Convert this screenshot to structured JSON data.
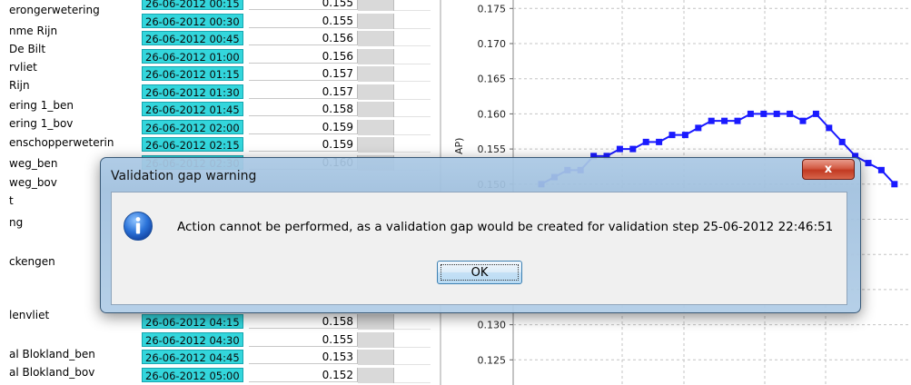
{
  "locations": [
    {
      "label": "erongerwetering",
      "y": 17
    },
    {
      "label": "nme Rijn",
      "y": 40
    },
    {
      "label": " De Bilt",
      "y": 60
    },
    {
      "label": "rvliet",
      "y": 80
    },
    {
      "label": " Rijn",
      "y": 100
    },
    {
      "label": "ering 1_ben",
      "y": 122
    },
    {
      "label": "ering 1_bov",
      "y": 142
    },
    {
      "label": "enschopperweterin",
      "y": 163
    },
    {
      "label": "weg_ben",
      "y": 186
    },
    {
      "label": "weg_bov",
      "y": 207
    },
    {
      "label": "t",
      "y": 227
    },
    {
      "label": "ng",
      "y": 251
    },
    {
      "label": "ckengen",
      "y": 294
    },
    {
      "label": "lenvliet",
      "y": 353
    },
    {
      "label": "al Blokland_ben",
      "y": 396
    },
    {
      "label": "al Blokland_bov",
      "y": 416
    }
  ],
  "table_rows": [
    {
      "date": "26-06-2012 00:15",
      "value": "0.155"
    },
    {
      "date": "26-06-2012 00:30",
      "value": "0.155"
    },
    {
      "date": "26-06-2012 00:45",
      "value": "0.156"
    },
    {
      "date": "26-06-2012 01:00",
      "value": "0.156"
    },
    {
      "date": "26-06-2012 01:15",
      "value": "0.157"
    },
    {
      "date": "26-06-2012 01:30",
      "value": "0.157"
    },
    {
      "date": "26-06-2012 01:45",
      "value": "0.158"
    },
    {
      "date": "26-06-2012 02:00",
      "value": "0.159"
    },
    {
      "date": "26-06-2012 02:15",
      "value": "0.159"
    },
    {
      "date": "26-06-2012 02:30",
      "value": "0.160"
    }
  ],
  "table_rows_bottom": [
    {
      "date": "26-06-2012 04:15",
      "value": "0.158"
    },
    {
      "date": "26-06-2012 04:30",
      "value": "0.155"
    },
    {
      "date": "26-06-2012 04:45",
      "value": "0.153"
    },
    {
      "date": "26-06-2012 05:00",
      "value": "0.152"
    }
  ],
  "chart": {
    "axis_label_fragment": "AP)",
    "y_ticks": [
      "0.175",
      "0.170",
      "0.165",
      "0.160",
      "0.155",
      "0.150",
      "0.145",
      "0.140",
      "0.135",
      "0.130",
      "0.125"
    ],
    "y_values": [
      0.175,
      0.17,
      0.165,
      0.16,
      0.155,
      0.15,
      0.145,
      0.14,
      0.135,
      0.13,
      0.125
    ],
    "series_color": "#1a1aff",
    "series": [
      0.15,
      0.151,
      0.152,
      0.152,
      0.154,
      0.154,
      0.155,
      0.155,
      0.156,
      0.156,
      0.157,
      0.157,
      0.158,
      0.159,
      0.159,
      0.159,
      0.16,
      0.16,
      0.16,
      0.16,
      0.159,
      0.16,
      0.158,
      0.156,
      0.154,
      0.153,
      0.152,
      0.15
    ]
  },
  "dialog": {
    "title": "Validation gap warning",
    "close_glyph": "x",
    "icon": "info-icon",
    "message": "Action cannot be performed, as a validation gap would be created for validation step 25-06-2012 22:46:51",
    "ok_label": "OK"
  }
}
